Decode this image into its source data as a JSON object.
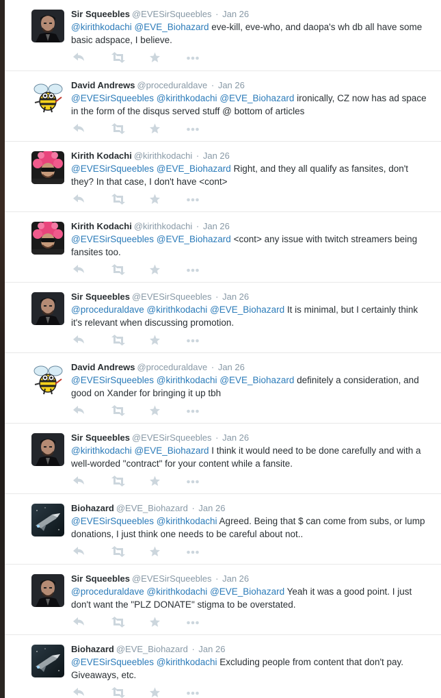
{
  "tweets": [
    {
      "name": "Sir Squeebles",
      "handle": "@EVESirSqueebles",
      "date": "Jan 26",
      "avatar": "portrait-man-dark",
      "parts": [
        {
          "m": "@kirithkodachi"
        },
        {
          "t": " "
        },
        {
          "m": "@EVE_Biohazard"
        },
        {
          "t": " eve-kill, eve-who, and daopa's wh db all have some basic adspace, I believe."
        }
      ]
    },
    {
      "name": "David Andrews",
      "handle": "@proceduraldave",
      "date": "Jan 26",
      "avatar": "cartoon-bee",
      "parts": [
        {
          "m": "@EVESirSqueebles"
        },
        {
          "t": " "
        },
        {
          "m": "@kirithkodachi"
        },
        {
          "t": " "
        },
        {
          "m": "@EVE_Biohazard"
        },
        {
          "t": " ironically, CZ now has ad space in the form of the disqus served stuff @ bottom of articles"
        }
      ]
    },
    {
      "name": "Kirith Kodachi",
      "handle": "@kirithkodachi",
      "date": "Jan 26",
      "avatar": "pink-hair-man",
      "parts": [
        {
          "m": "@EVESirSqueebles"
        },
        {
          "t": " "
        },
        {
          "m": "@EVE_Biohazard"
        },
        {
          "t": " Right, and they all qualify as fansites, don't they? In that case, I don't have <cont>"
        }
      ]
    },
    {
      "name": "Kirith Kodachi",
      "handle": "@kirithkodachi",
      "date": "Jan 26",
      "avatar": "pink-hair-man",
      "parts": [
        {
          "m": "@EVESirSqueebles"
        },
        {
          "t": " "
        },
        {
          "m": "@EVE_Biohazard"
        },
        {
          "t": " <cont> any issue with twitch streamers being fansites too."
        }
      ]
    },
    {
      "name": "Sir Squeebles",
      "handle": "@EVESirSqueebles",
      "date": "Jan 26",
      "avatar": "portrait-man-dark",
      "parts": [
        {
          "m": "@proceduraldave"
        },
        {
          "t": " "
        },
        {
          "m": "@kirithkodachi"
        },
        {
          "t": " "
        },
        {
          "m": "@EVE_Biohazard"
        },
        {
          "t": " It is minimal, but I certainly think it's relevant when discussing promotion."
        }
      ]
    },
    {
      "name": "David Andrews",
      "handle": "@proceduraldave",
      "date": "Jan 26",
      "avatar": "cartoon-bee",
      "parts": [
        {
          "m": "@EVESirSqueebles"
        },
        {
          "t": " "
        },
        {
          "m": "@kirithkodachi"
        },
        {
          "t": " "
        },
        {
          "m": "@EVE_Biohazard"
        },
        {
          "t": " definitely a consideration, and good on Xander for bringing it up tbh"
        }
      ]
    },
    {
      "name": "Sir Squeebles",
      "handle": "@EVESirSqueebles",
      "date": "Jan 26",
      "avatar": "portrait-man-dark",
      "parts": [
        {
          "m": "@kirithkodachi"
        },
        {
          "t": " "
        },
        {
          "m": "@EVE_Biohazard"
        },
        {
          "t": " I think it would need to be done carefully and with a well-worded \"contract\" for your content while a fansite."
        }
      ]
    },
    {
      "name": "Biohazard",
      "handle": "@EVE_Biohazard",
      "date": "Jan 26",
      "avatar": "spaceship",
      "parts": [
        {
          "m": "@EVESirSqueebles"
        },
        {
          "t": " "
        },
        {
          "m": "@kirithkodachi"
        },
        {
          "t": " Agreed. Being that $ can come from subs, or lump donations, I just think one needs to be careful about not.."
        }
      ]
    },
    {
      "name": "Sir Squeebles",
      "handle": "@EVESirSqueebles",
      "date": "Jan 26",
      "avatar": "portrait-man-dark",
      "parts": [
        {
          "m": "@proceduraldave"
        },
        {
          "t": " "
        },
        {
          "m": "@kirithkodachi"
        },
        {
          "t": " "
        },
        {
          "m": "@EVE_Biohazard"
        },
        {
          "t": " Yeah it was a good point. I just don't want the \"PLZ DONATE\" stigma to be overstated."
        }
      ]
    },
    {
      "name": "Biohazard",
      "handle": "@EVE_Biohazard",
      "date": "Jan 26",
      "avatar": "spaceship",
      "parts": [
        {
          "m": "@EVESirSqueebles"
        },
        {
          "t": " "
        },
        {
          "m": "@kirithkodachi"
        },
        {
          "t": " Excluding people from content that don't pay.  Giveaways, etc."
        }
      ]
    }
  ],
  "separator": "·",
  "icons": {
    "reply": "reply-icon",
    "retweet": "retweet-icon",
    "favorite": "favorite-star-icon",
    "more": "more-dots-icon"
  },
  "colors": {
    "mention": "#2b7bb9",
    "name": "#292f33",
    "meta": "#8899a6",
    "icon": "#ccd6dd"
  }
}
